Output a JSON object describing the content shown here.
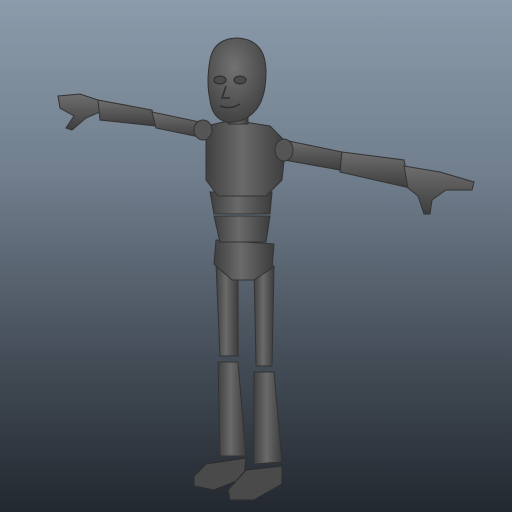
{
  "viewport": {
    "background_top": "#8c9bab",
    "background_bottom": "#232830",
    "model_color": "#5e5e5e",
    "model_shadow": "#3a3a3a",
    "model_highlight": "#858585"
  },
  "model": {
    "type": "mannequin-figure",
    "pose": "t-pose"
  }
}
